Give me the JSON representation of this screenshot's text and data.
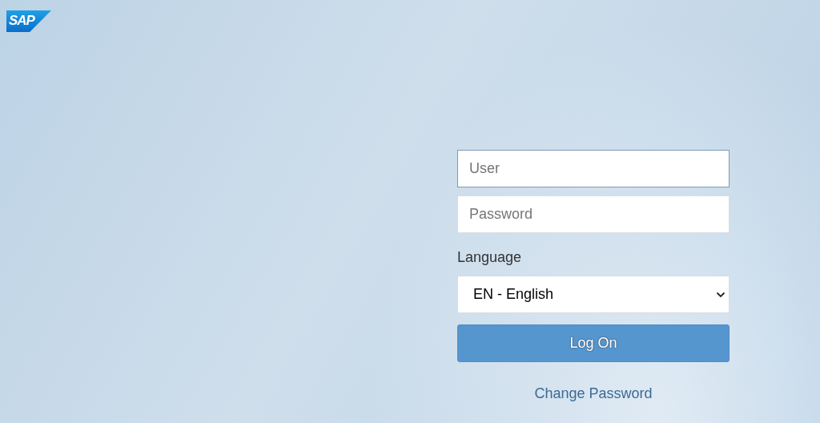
{
  "logo": {
    "text": "SAP"
  },
  "login": {
    "user": {
      "placeholder": "User",
      "focused": true
    },
    "password": {
      "placeholder": "Password",
      "focused": false
    },
    "language_label": "Language",
    "language": {
      "value": "EN - English"
    },
    "log_on_button": "Log On",
    "change_password_link": "Change Password"
  }
}
